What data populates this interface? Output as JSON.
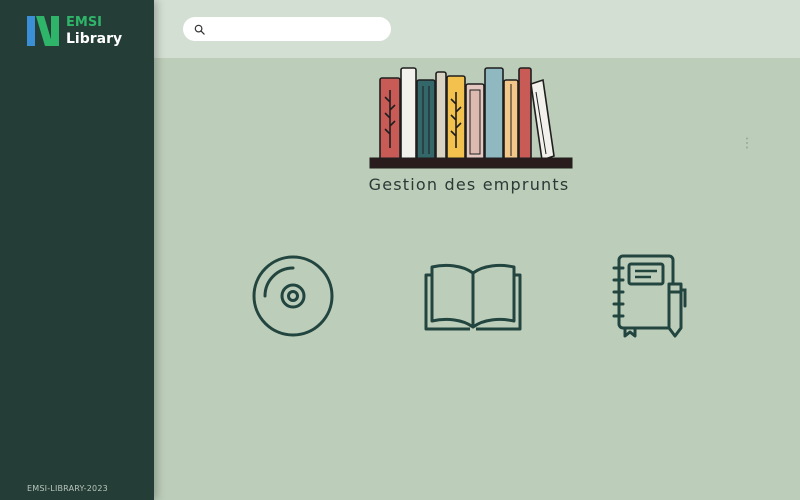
{
  "brand": {
    "name_line1": "EMSI",
    "name_line2": "Library",
    "accent_green": "#2fb56a",
    "accent_blue": "#3b8fd6"
  },
  "sidebar": {
    "footer_text": "EMSI-LIBRARY-2023"
  },
  "search": {
    "placeholder": "",
    "value": "",
    "icon": "search-icon"
  },
  "main": {
    "title": "Gestion des emprunts",
    "illustration": "bookshelf-illustration",
    "menu_icon": "more-vertical-icon",
    "categories": [
      {
        "icon": "cd-icon"
      },
      {
        "icon": "open-book-icon"
      },
      {
        "icon": "notebook-pen-icon"
      }
    ]
  },
  "colors": {
    "sidebar_bg": "#243d37",
    "topbar_bg": "#d3dfd2",
    "main_bg": "#bccdb9",
    "icon_stroke": "#234540"
  }
}
